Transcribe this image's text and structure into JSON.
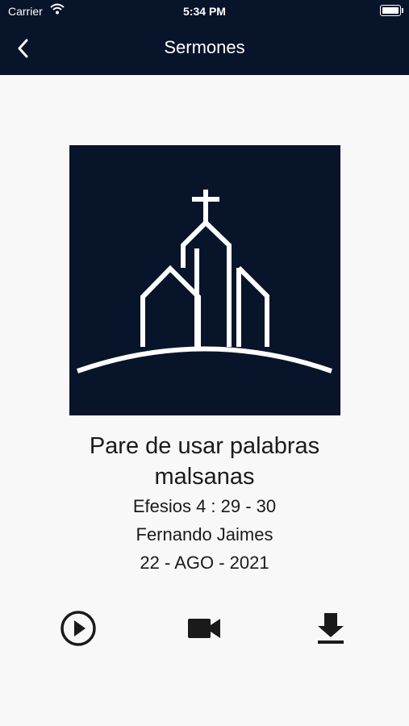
{
  "status": {
    "carrier": "Carrier",
    "time": "5:34 PM"
  },
  "header": {
    "title": "Sermones",
    "back_icon": "chevron-left-icon"
  },
  "sermon": {
    "title": "Pare de usar palabras malsanas",
    "passage": "Efesios 4 : 29 - 30",
    "speaker": "Fernando Jaimes",
    "date": "22 - AGO - 2021"
  },
  "actions": {
    "play_icon": "play-circle-icon",
    "video_icon": "video-camera-icon",
    "download_icon": "download-icon"
  },
  "colors": {
    "navy": "#07142a",
    "background": "#f8f8f8",
    "text": "#1a1a1a"
  }
}
